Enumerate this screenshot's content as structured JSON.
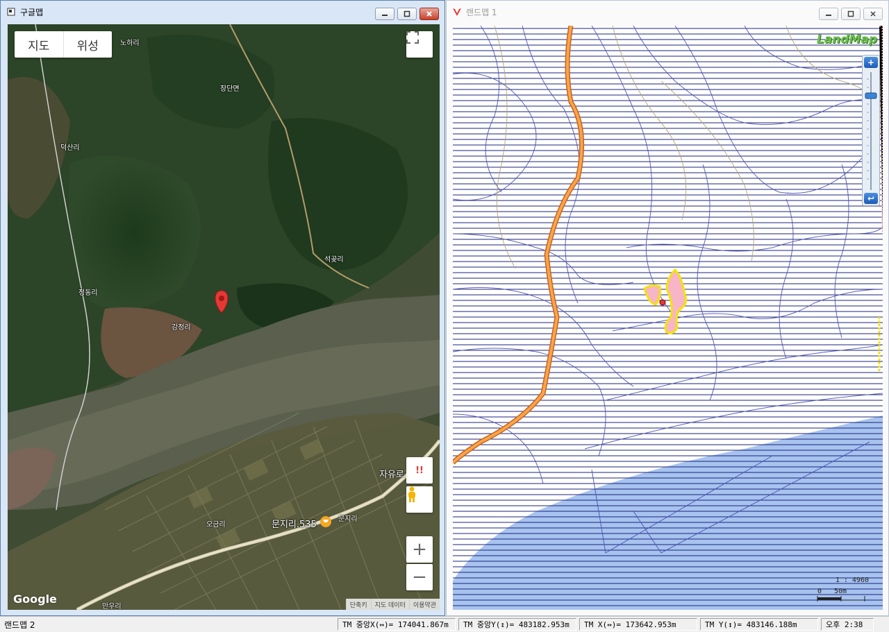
{
  "left_window": {
    "title": "구글맵",
    "map_type_tabs": [
      "지도",
      "위성"
    ],
    "places": {
      "noha": "노하리",
      "jangdan": "장단면",
      "deoksan": "덕산리",
      "seokgot": "석곶리",
      "jeongdong": "정동리",
      "gangjeong": "강정리",
      "ogeum": "오금리",
      "munji": "문지리",
      "mangu": "만우리",
      "jayuro": "자유로",
      "poi_munji": "문지리.535"
    },
    "google_logo": "Google",
    "footer": [
      "단축키",
      "지도 데이터",
      "이용약관"
    ],
    "zoom_in": "+",
    "zoom_out": "−",
    "alert": "!!",
    "fullscreen_icon": "fullscreen-icon"
  },
  "right_window": {
    "title": "랜드맵 1",
    "logo": "LandMap",
    "zoom_in": "+",
    "zoom_out": "↩",
    "scale_ratio": "1 : 4960",
    "scale_zero": "0",
    "scale_dist": "50m"
  },
  "status_bar": {
    "app_name": "랜드맵 2",
    "tm_center_x": "TM 중앙X(↔)= 174041.867m",
    "tm_center_y": "TM 중앙Y(↕)= 483182.953m",
    "tm_x": "TM X(↔)= 173642.953m",
    "tm_y": "TM Y(↕)= 483146.188m",
    "clock": "오후 2:38"
  },
  "colors": {
    "road_orange": "#f39a3c",
    "parcel_line": "#1a237e",
    "water_blue": "#a7c3ee",
    "highlight": "#f7b6c8",
    "marker_red": "#e53935"
  }
}
